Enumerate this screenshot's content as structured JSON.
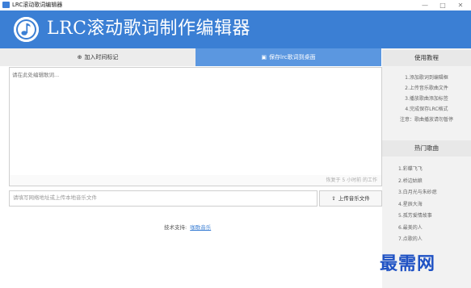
{
  "window": {
    "title": "LRC滚动歌词编辑器",
    "minimize_glyph": "—",
    "maximize_glyph": "□",
    "close_glyph": "✕",
    "icon": "music-note-icon"
  },
  "header": {
    "title": "LRC滚动歌词制作编辑器",
    "background_color": "#3b7fd4",
    "logo_icon": "music-note-logo-icon"
  },
  "tabs": {
    "add_time_tag": {
      "label": "加入时间标记",
      "icon": "plus-circle-icon"
    },
    "save_lrc": {
      "label": "保存lrc歌词到桌面",
      "icon": "floppy-disk-icon"
    }
  },
  "editor": {
    "placeholder": "请在此处编辑歌词...",
    "value": ""
  },
  "status": {
    "saved_text": "恢复于 5 小时前 的工作"
  },
  "music_source": {
    "placeholder": "请填写网络地址或上传本地音乐文件",
    "upload_label": "上传音乐文件",
    "upload_icon": "upload-icon"
  },
  "footer": {
    "support_label": "技术支持:",
    "support_link": "咖歌音乐"
  },
  "sidebar": {
    "tutorial_title": "使用教程",
    "steps": [
      "1.添加歌词到编辑框",
      "2.上传音乐歌曲文件",
      "3.播放歌曲添加标签",
      "4.完成保存LRC格式",
      "注意：歌曲播放请勿暂停"
    ],
    "hot_title": "热门歌曲",
    "songs": [
      "1.彩蝶飞飞",
      "2.桥边姑娘",
      "3.白月光与朱砂痣",
      "4.星辰大海",
      "5.孤芳爱情故事",
      "6.最美的人",
      "7.点歌的人"
    ]
  },
  "watermark": {
    "text": "最需网",
    "color": "#1f52c4"
  },
  "colors": {
    "accent": "#3b7fd4",
    "active_tab": "#5b97e0",
    "sidebar_bg": "#f2f2f2"
  }
}
